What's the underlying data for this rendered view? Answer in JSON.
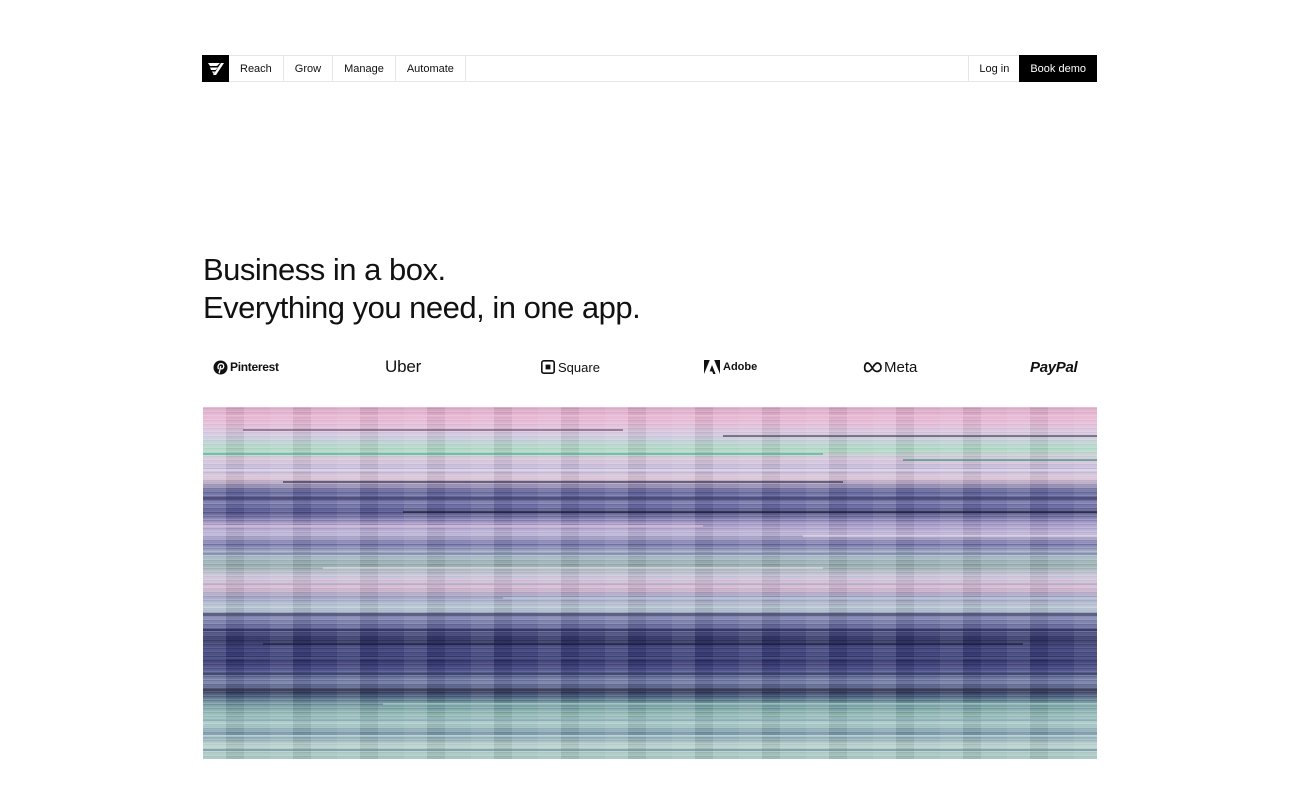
{
  "nav": {
    "logo_icon": "brand-mark-icon",
    "menu": [
      {
        "label": "Reach"
      },
      {
        "label": "Grow"
      },
      {
        "label": "Manage"
      },
      {
        "label": "Automate"
      }
    ],
    "login_label": "Log in",
    "demo_label": "Book demo"
  },
  "hero": {
    "headline_line1": "Business in a box.",
    "headline_line2": "Everything you need, in one app."
  },
  "logos": {
    "pinterest": "Pinterest",
    "uber": "Uber",
    "square": "Square",
    "adobe": "Adobe",
    "meta": "Meta",
    "paypal": "PayPal"
  },
  "colors": {
    "accent": "#000000",
    "background": "#ffffff",
    "border": "#e6e6e6"
  }
}
